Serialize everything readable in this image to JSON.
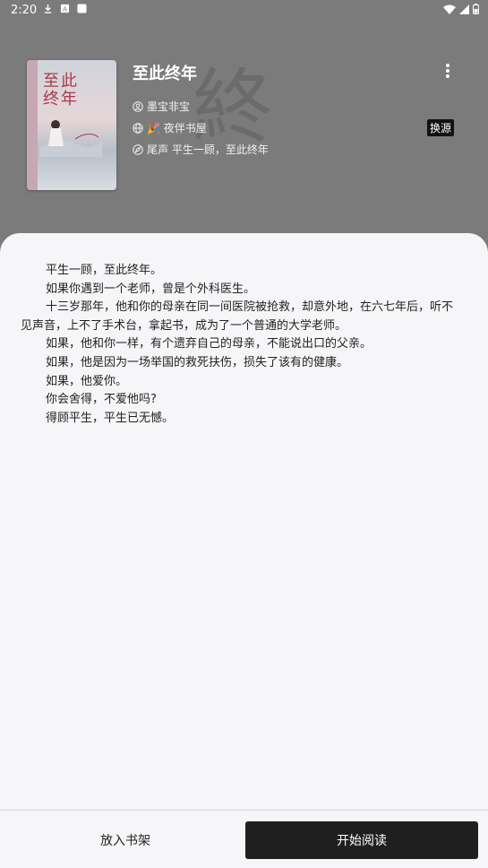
{
  "status_bar": {
    "time": "2:20"
  },
  "book": {
    "title": "至此终年",
    "cover_title": "至此\n终年",
    "author": "墨宝非宝",
    "source": "🎉 夜伴书屋",
    "latest_chapter": "尾声 平生一顾，至此终年",
    "switch_source_label": "换源"
  },
  "intro": {
    "paragraphs": [
      "平生一顾，至此终年。",
      "如果你遇到一个老师，曾是个外科医生。",
      "十三岁那年，他和你的母亲在同一间医院被抢救，却意外地，在六七年后，听不见声音，上不了手术台，拿起书，成为了一个普通的大学老师。",
      "如果，他和你一样，有个遗弃自己的母亲，不能说出口的父亲。",
      "如果，他是因为一场举国的救死扶伤，损失了该有的健康。",
      "如果，他爱你。",
      "你会舍得，不爱他吗?",
      "得顾平生，平生已无憾。"
    ]
  },
  "actions": {
    "add_to_shelf": "放入书架",
    "start_reading": "开始阅读"
  },
  "colors": {
    "overlay": "#7b7b7b",
    "sheet": "#f6f6f8",
    "primary_button": "#1f1f1f"
  }
}
